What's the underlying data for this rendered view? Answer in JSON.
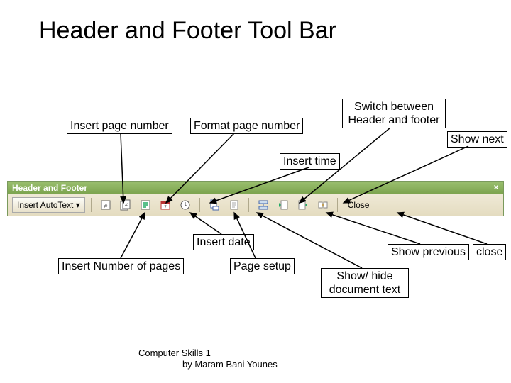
{
  "title": "Header and Footer Tool Bar",
  "callouts": {
    "insert_page_number": "Insert page number",
    "format_page_number": "Format page number",
    "switch": "Switch between Header and footer",
    "show_next": "Show next",
    "insert_time": "Insert time",
    "insert_date": "Insert date",
    "show_previous": "Show previous",
    "close": "close",
    "page_setup": "Page setup",
    "insert_num_pages": "Insert Number of pages",
    "show_hide": "Show/ hide document text"
  },
  "toolbar": {
    "title": "Header and Footer",
    "autotext": "Insert AutoText",
    "close": "Close"
  },
  "footer": {
    "line1": "Computer Skills 1",
    "line2": "by Maram Bani Younes"
  }
}
